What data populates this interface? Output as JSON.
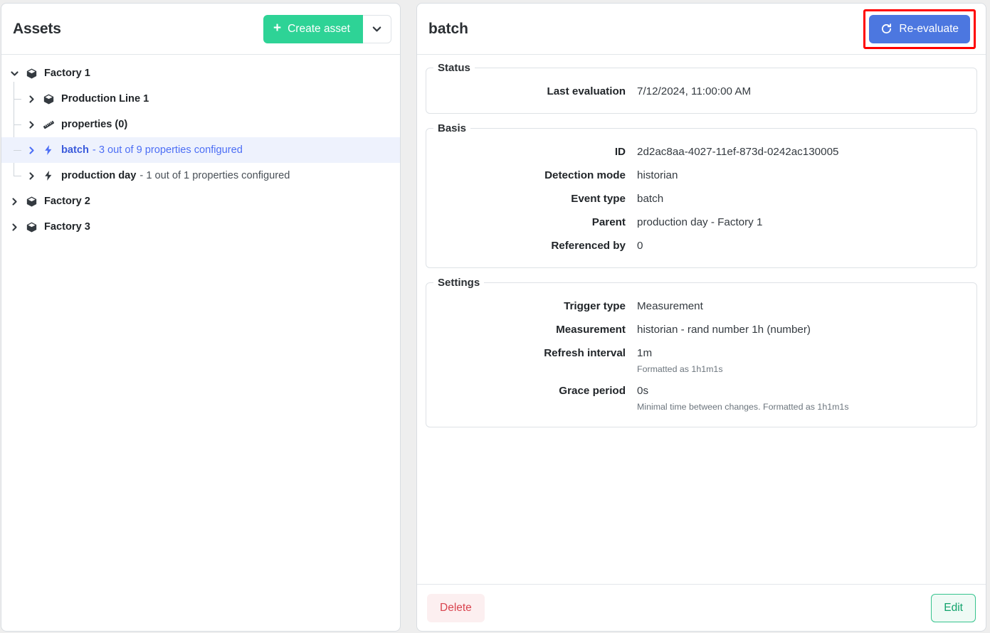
{
  "sidebar": {
    "title": "Assets",
    "create_button": {
      "label": "Create asset",
      "icon": "plus-icon",
      "color": "#2ed396"
    },
    "create_caret": {
      "icon": "chevron-down-icon"
    },
    "tree": [
      {
        "label": "Factory 1",
        "sub": "",
        "icon": "cube-icon",
        "expanded": true,
        "twisty": "chevron-down-icon",
        "level": 0,
        "selected": false
      },
      {
        "label": "Production Line 1",
        "sub": "",
        "icon": "cube-icon",
        "expanded": false,
        "twisty": "chevron-right-icon",
        "level": 1,
        "selected": false
      },
      {
        "label": "properties (0)",
        "sub": "",
        "icon": "ruler-icon",
        "expanded": false,
        "twisty": "chevron-right-icon",
        "level": 1,
        "selected": false
      },
      {
        "label": "batch",
        "sub": "- 3 out of 9 properties configured",
        "icon": "bolt-icon",
        "expanded": false,
        "twisty": "chevron-right-icon",
        "level": 1,
        "selected": true
      },
      {
        "label": "production day",
        "sub": "- 1 out of 1 properties configured",
        "icon": "bolt-icon",
        "expanded": false,
        "twisty": "chevron-right-icon",
        "level": 1,
        "selected": false
      },
      {
        "label": "Factory 2",
        "sub": "",
        "icon": "cube-icon",
        "expanded": false,
        "twisty": "chevron-right-icon",
        "level": 0,
        "selected": false
      },
      {
        "label": "Factory 3",
        "sub": "",
        "icon": "cube-icon",
        "expanded": false,
        "twisty": "chevron-right-icon",
        "level": 0,
        "selected": false
      }
    ]
  },
  "detail": {
    "title": "batch",
    "reevaluate_button": {
      "label": "Re-evaluate",
      "icon": "refresh-icon",
      "color": "#4c77e0",
      "highlight_color": "#ff0000"
    },
    "groups": [
      {
        "legend": "Status",
        "fields": [
          {
            "label": "Last evaluation",
            "value": "7/12/2024, 11:00:00 AM",
            "hint": ""
          }
        ]
      },
      {
        "legend": "Basis",
        "fields": [
          {
            "label": "ID",
            "value": "2d2ac8aa-4027-11ef-873d-0242ac130005",
            "hint": ""
          },
          {
            "label": "Detection mode",
            "value": "historian",
            "hint": ""
          },
          {
            "label": "Event type",
            "value": "batch",
            "hint": ""
          },
          {
            "label": "Parent",
            "value": "production day - Factory 1",
            "hint": ""
          },
          {
            "label": "Referenced by",
            "value": "0",
            "hint": ""
          }
        ]
      },
      {
        "legend": "Settings",
        "fields": [
          {
            "label": "Trigger type",
            "value": "Measurement",
            "hint": ""
          },
          {
            "label": "Measurement",
            "value": "historian - rand number 1h (number)",
            "hint": ""
          },
          {
            "label": "Refresh interval",
            "value": "1m",
            "hint": "Formatted as 1h1m1s"
          },
          {
            "label": "Grace period",
            "value": "0s",
            "hint": "Minimal time between changes. Formatted as 1h1m1s"
          }
        ]
      }
    ],
    "footer": {
      "delete_label": "Delete",
      "edit_label": "Edit",
      "delete_color": "#d9444f",
      "edit_color": "#12a36c"
    }
  }
}
